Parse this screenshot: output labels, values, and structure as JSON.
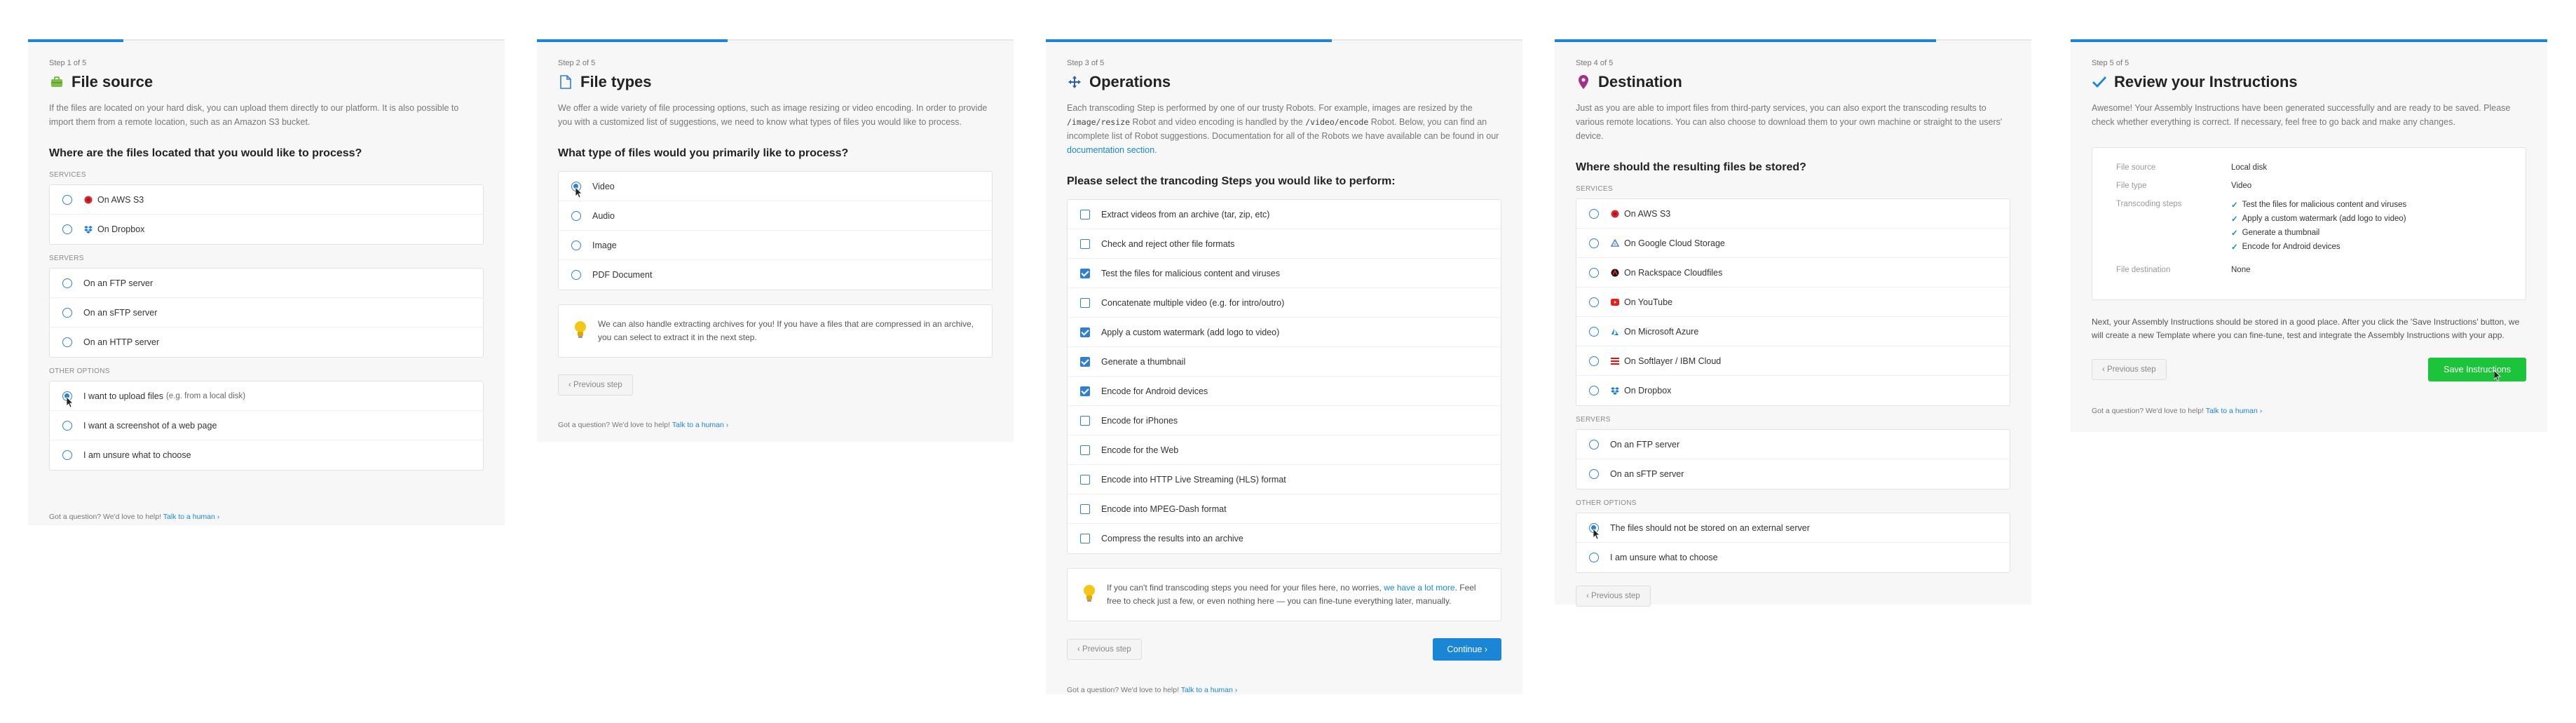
{
  "footer": {
    "text": "Got a question? We'd love to help!",
    "link": "Talk to a human ›"
  },
  "prev_label": "‹ Previous step",
  "colors": {
    "accent": "#1b86d6",
    "success": "#1bc43a"
  },
  "step1": {
    "step": "Step 1 of 5",
    "title": "File source",
    "desc": "If the files are located on your hard disk, you can upload them directly to our platform. It is also possible to import them from a remote location, such as an Amazon S3 bucket.",
    "question": "Where are the files located that you would like to process?",
    "services_label": "SERVICES",
    "services": [
      "On AWS S3",
      "On Dropbox"
    ],
    "servers_label": "SERVERS",
    "servers": [
      "On an FTP server",
      "On an sFTP server",
      "On an HTTP server"
    ],
    "other_label": "OTHER OPTIONS",
    "other": [
      {
        "label": "I want to upload files",
        "hint": "(e.g. from a local disk)",
        "selected": true
      },
      {
        "label": "I want a screenshot of a web page",
        "hint": "",
        "selected": false
      },
      {
        "label": "I am unsure what to choose",
        "hint": "",
        "selected": false
      }
    ]
  },
  "step2": {
    "step": "Step 2 of 5",
    "title": "File types",
    "desc": "We offer a wide variety of file processing options, such as image resizing or video encoding. In order to provide you with a customized list of suggestions, we need to know what types of files you would like to process.",
    "question": "What type of files would you primarily like to process?",
    "options": [
      {
        "label": "Video",
        "selected": true
      },
      {
        "label": "Audio",
        "selected": false
      },
      {
        "label": "Image",
        "selected": false
      },
      {
        "label": "PDF Document",
        "selected": false
      }
    ],
    "tip": "We can also handle extracting archives for you! If you have a files that are compressed in an archive, you can select to extract it in the next step."
  },
  "step3": {
    "step": "Step 3 of 5",
    "title": "Operations",
    "desc_1": "Each transcoding Step is performed by one of our trusty Robots. For example, images are resized by the",
    "code_1": "/image/resize",
    "desc_2": "Robot and video encoding is handled by the",
    "code_2": "/video/encode",
    "desc_3": "Robot. Below, you can find an incomplete list of Robot suggestions. Documentation for all of the Robots we have available can be found in our",
    "doc_link": "documentation section",
    "question": "Please select the trancoding Steps you would like to perform:",
    "options": [
      {
        "label": "Extract videos from an archive (tar, zip, etc)",
        "checked": false
      },
      {
        "label": "Check and reject other file formats",
        "checked": false
      },
      {
        "label": "Test the files for malicious content and viruses",
        "checked": true
      },
      {
        "label": "Concatenate multiple video (e.g. for intro/outro)",
        "checked": false
      },
      {
        "label": "Apply a custom watermark (add logo to video)",
        "checked": true
      },
      {
        "label": "Generate a thumbnail",
        "checked": true
      },
      {
        "label": "Encode for Android devices",
        "checked": true
      },
      {
        "label": "Encode for iPhones",
        "checked": false
      },
      {
        "label": "Encode for the Web",
        "checked": false
      },
      {
        "label": "Encode into HTTP Live Streaming (HLS) format",
        "checked": false
      },
      {
        "label": "Encode into MPEG-Dash format",
        "checked": false
      },
      {
        "label": "Compress the results into an archive",
        "checked": false
      }
    ],
    "tip_1": "If you can't find transcoding steps you need for your files here, no worries,",
    "tip_link": "we have a lot more",
    "tip_2": ". Feel free to check just a few, or even nothing here — you can fine-tune everything later, manually.",
    "continue": "Continue ›"
  },
  "step4": {
    "step": "Step 4 of 5",
    "title": "Destination",
    "desc": "Just as you are able to import files from third-party services, you can also export the transcoding results to various remote locations. You can also choose to download them to your own machine or straight to the users' device.",
    "question": "Where should the resulting files be stored?",
    "services_label": "SERVICES",
    "services": [
      "On AWS S3",
      "On Google Cloud Storage",
      "On Rackspace Cloudfiles",
      "On YouTube",
      "On Microsoft Azure",
      "On Softlayer / IBM Cloud",
      "On Dropbox"
    ],
    "servers_label": "SERVERS",
    "servers": [
      "On an FTP server",
      "On an sFTP server"
    ],
    "other_label": "OTHER OPTIONS",
    "other": [
      {
        "label": "The files should not be stored on an external server",
        "selected": true
      },
      {
        "label": "I am unsure what to choose",
        "selected": false
      }
    ]
  },
  "step5": {
    "step": "Step 5 of 5",
    "title": "Review your Instructions",
    "desc": "Awesome! Your Assembly Instructions have been generated successfully and are ready to be saved. Please check whether everything is correct. If necessary, feel free to go back and make any changes.",
    "rows": {
      "source_k": "File source",
      "source_v": "Local disk",
      "type_k": "File type",
      "type_v": "Video",
      "steps_k": "Transcoding steps",
      "steps": [
        "Test the files for malicious content and viruses",
        "Apply a custom watermark (add logo to video)",
        "Generate a thumbnail",
        "Encode for Android devices"
      ],
      "dest_k": "File destination",
      "dest_v": "None"
    },
    "next_text": "Next, your Assembly Instructions should be stored in a good place. After you click the 'Save Instructions' button, we will create a new Template where you can fine-tune, test and integrate the Assembly Instructions with your app.",
    "save": "Save Instructions"
  }
}
